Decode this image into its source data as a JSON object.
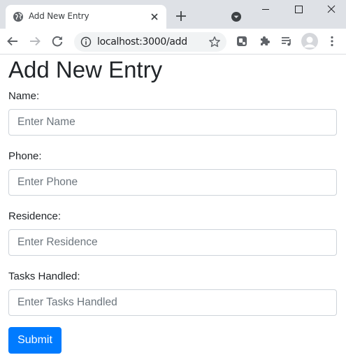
{
  "browser": {
    "tab_title": "Add New Entry",
    "url": "localhost:3000/add"
  },
  "form": {
    "heading": "Add New Entry",
    "fields": [
      {
        "label": "Name:",
        "placeholder": "Enter Name",
        "value": ""
      },
      {
        "label": "Phone:",
        "placeholder": "Enter Phone",
        "value": ""
      },
      {
        "label": "Residence:",
        "placeholder": "Enter Residence",
        "value": ""
      },
      {
        "label": "Tasks Handled:",
        "placeholder": "Enter Tasks Handled",
        "value": ""
      }
    ],
    "submit_label": "Submit"
  },
  "icons": {
    "tab": "globe-icon",
    "tab_close": "close-icon",
    "new_tab": "plus-icon",
    "tab_search": "tab-search-icon",
    "back": "back-arrow-icon",
    "forward": "forward-arrow-icon",
    "reload": "reload-icon",
    "site_info": "info-icon",
    "bookmark": "star-icon",
    "extensions": [
      "extension-app-icon",
      "puzzle-icon",
      "reading-list-icon"
    ],
    "profile": "avatar-icon",
    "menu": "kebab-menu-icon"
  },
  "colors": {
    "primary": "#007bff",
    "tabstrip": "#dee1e6",
    "omnibox": "#f1f3f4",
    "input_border": "#ced4da",
    "placeholder": "#6c757d",
    "text": "#212529"
  }
}
